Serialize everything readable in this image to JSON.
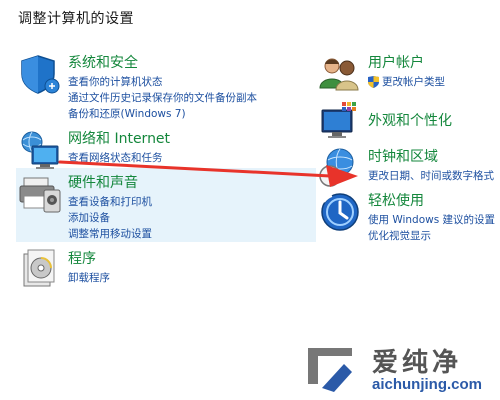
{
  "page": {
    "title": "调整计算机的设置"
  },
  "left": [
    {
      "id": "security",
      "title": "系统和安全",
      "icon": "shield-icon",
      "links": [
        "查看你的计算机状态",
        "通过文件历史记录保存你的文件备份副本",
        "备份和还原(Windows 7)"
      ]
    },
    {
      "id": "network",
      "title": "网络和 Internet",
      "icon": "network-icon",
      "links": [
        "查看网络状态和任务"
      ]
    },
    {
      "id": "hardware",
      "title": "硬件和声音",
      "icon": "printer-icon",
      "links": [
        "查看设备和打印机",
        "添加设备",
        "调整常用移动设置"
      ]
    },
    {
      "id": "programs",
      "title": "程序",
      "icon": "programs-icon",
      "links": [
        "卸载程序"
      ]
    }
  ],
  "right": [
    {
      "id": "accounts",
      "title": "用户帐户",
      "icon": "users-icon",
      "links": [
        "更改帐户类型"
      ]
    },
    {
      "id": "appearance",
      "title": "外观和个性化",
      "icon": "appearance-icon",
      "links": []
    },
    {
      "id": "clock",
      "title": "时钟和区域",
      "icon": "clock-globe-icon",
      "links": [
        "更改日期、时间或数字格式"
      ]
    },
    {
      "id": "ease",
      "title": "轻松使用",
      "icon": "ease-of-access-icon",
      "links": [
        "使用 Windows 建议的设置",
        "优化视觉显示"
      ]
    }
  ],
  "annotation": {
    "color": "#e8332a"
  },
  "watermark": {
    "name": "爱纯净",
    "url": "aichunjing.com"
  },
  "colors": {
    "title_green": "#14873c",
    "link_blue": "#1e50a0",
    "highlight": "#e6f3fb"
  }
}
